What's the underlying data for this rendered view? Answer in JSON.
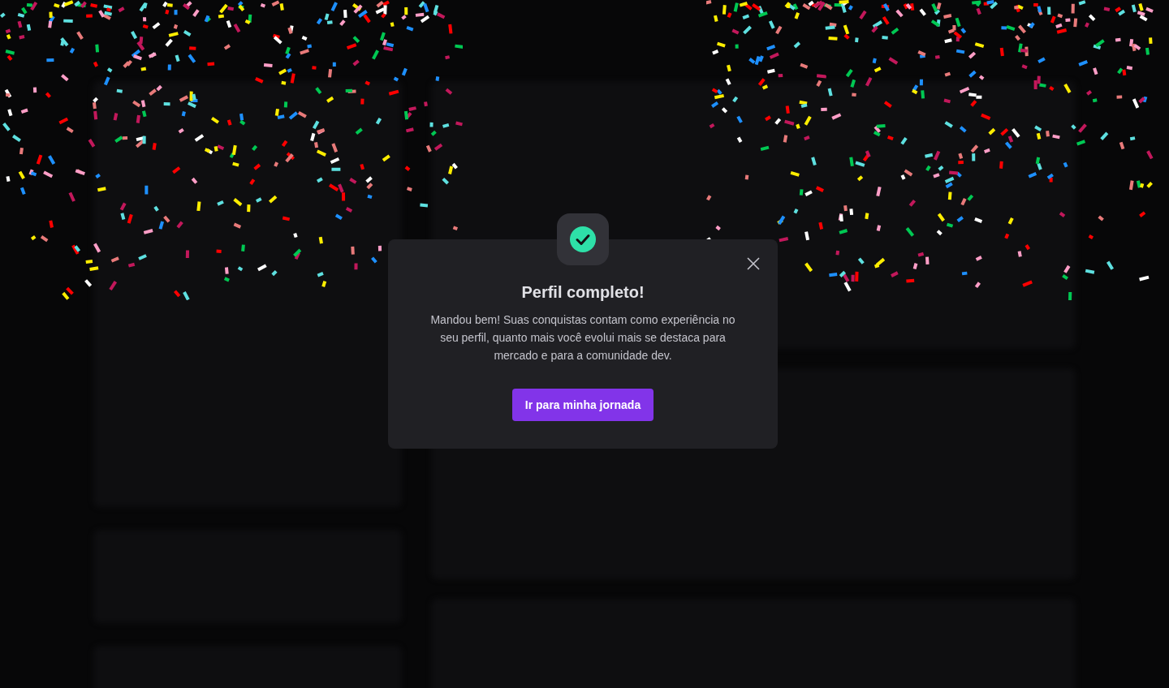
{
  "modal": {
    "title": "Perfil completo!",
    "message": "Mandou bem! Suas conquistas contam como experiência no seu perfil, quanto mais você evolui mais se destaca para mercado e para a comunidade dev.",
    "button": "Ir para minha jornada"
  }
}
